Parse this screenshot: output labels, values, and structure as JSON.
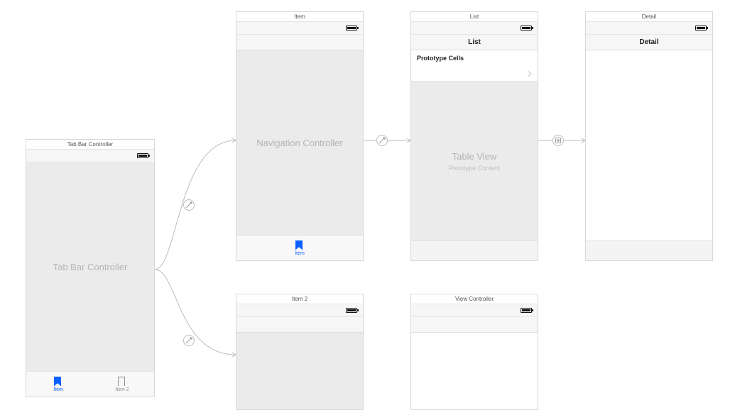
{
  "scenes": {
    "tabbar": {
      "title": "Tab Bar Controller",
      "placeholder": "Tab Bar Controller",
      "tabs": [
        {
          "label": "Item",
          "active": true
        },
        {
          "label": "Item 2",
          "active": false
        }
      ]
    },
    "nav_item": {
      "title": "Item",
      "placeholder": "Navigation Controller",
      "tab_label": "Item"
    },
    "list": {
      "title": "List",
      "nav_title": "List",
      "proto_header": "Prototype Cells",
      "placeholder_title": "Table View",
      "placeholder_sub": "Prototype Content"
    },
    "detail": {
      "title": "Detail",
      "nav_title": "Detail"
    },
    "nav_item2": {
      "title": "Item 2"
    },
    "view_controller": {
      "title": "View Controller"
    }
  }
}
